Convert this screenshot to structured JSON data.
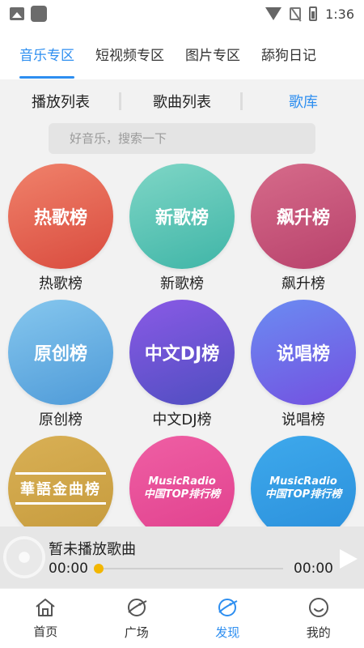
{
  "status_bar": {
    "time": "1:36"
  },
  "top_tabs": [
    {
      "label": "音乐专区",
      "active": true
    },
    {
      "label": "短视频专区",
      "active": false
    },
    {
      "label": "图片专区",
      "active": false
    },
    {
      "label": "舔狗日记",
      "active": false
    }
  ],
  "sub_tabs": [
    {
      "label": "播放列表",
      "active": false
    },
    {
      "label": "歌曲列表",
      "active": false
    },
    {
      "label": "歌库",
      "active": true
    }
  ],
  "search": {
    "placeholder": "好音乐，搜索一下"
  },
  "charts": [
    {
      "circle_text": "热歌榜",
      "label": "热歌榜"
    },
    {
      "circle_text": "新歌榜",
      "label": "新歌榜"
    },
    {
      "circle_text": "飙升榜",
      "label": "飙升榜"
    },
    {
      "circle_text": "原创榜",
      "label": "原创榜"
    },
    {
      "circle_text": "中文DJ榜",
      "label": "中文DJ榜"
    },
    {
      "circle_text": "说唱榜",
      "label": "说唱榜"
    },
    {
      "circle_text": "華語金曲榜",
      "label": ""
    },
    {
      "circle_text_line1": "MusicRadio",
      "circle_text_line2": "中国TOP排行榜",
      "label": ""
    },
    {
      "circle_text_line1": "MusicRadio",
      "circle_text_line2": "中国TOP排行榜",
      "label": ""
    }
  ],
  "player": {
    "title": "暂未播放歌曲",
    "current_time": "00:00",
    "total_time": "00:00",
    "progress": 0
  },
  "bottom_nav": [
    {
      "label": "首页",
      "icon": "home-icon",
      "active": false
    },
    {
      "label": "广场",
      "icon": "planet-icon",
      "active": false
    },
    {
      "label": "发现",
      "icon": "planet-icon",
      "active": true
    },
    {
      "label": "我的",
      "icon": "smile-icon",
      "active": false
    }
  ],
  "colors": {
    "accent": "#2d8ef0",
    "progress_knob": "#f2b600"
  }
}
